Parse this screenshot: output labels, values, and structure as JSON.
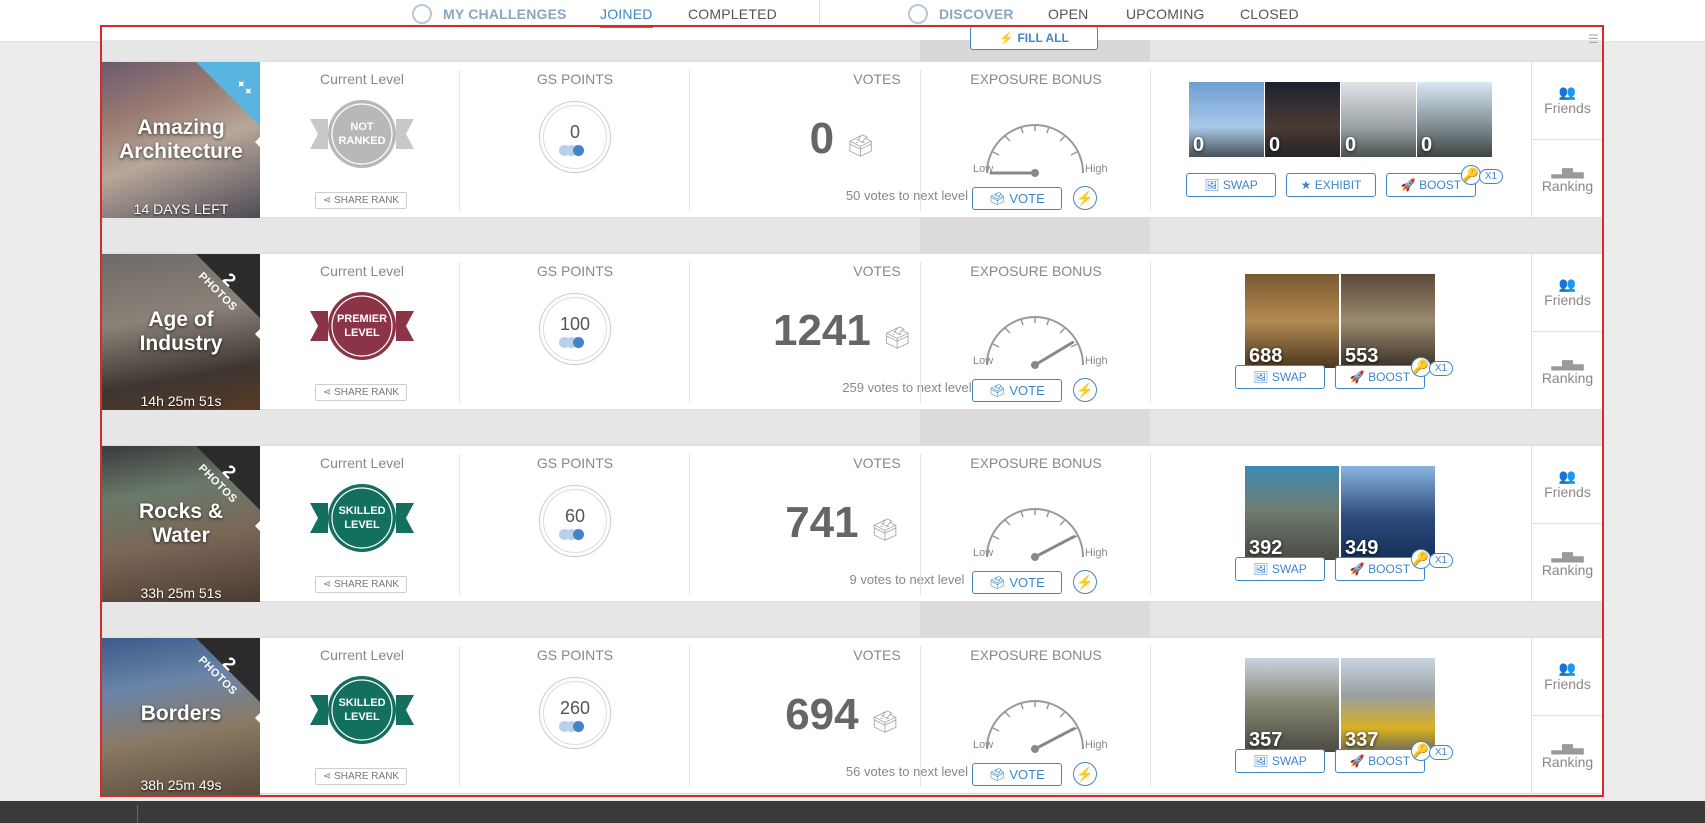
{
  "nav": {
    "my_challenges": "MY CHALLENGES",
    "joined": "JOINED",
    "completed": "COMPLETED",
    "discover": "DISCOVER",
    "open": "OPEN",
    "upcoming": "UPCOMING",
    "closed": "CLOSED"
  },
  "fill_all": "FILL ALL",
  "labels": {
    "current_level": "Current Level",
    "gs_points": "GS POINTS",
    "votes": "VOTES",
    "exposure_bonus": "EXPOSURE BONUS",
    "low": "Low",
    "high": "High",
    "share_rank": "SHARE RANK",
    "vote": "VOTE",
    "swap": "SWAP",
    "exhibit": "EXHIBIT",
    "boost": "BOOST",
    "x1": "X1",
    "friends": "Friends",
    "ranking": "Ranking"
  },
  "challenges": [
    {
      "title_line1": "Amazing",
      "title_line2": "Architecture",
      "timer": "14 DAYS LEFT",
      "ribbon": "",
      "level_line1": "NOT",
      "level_line2": "RANKED",
      "level_color": "#b8b8b8",
      "gs_points": "0",
      "votes": "0",
      "votes_next": "50 votes to next level",
      "exposure": 0.0,
      "photo_counts": [
        "0",
        "0",
        "0",
        "0"
      ]
    },
    {
      "title_line1": "Age of",
      "title_line2": "Industry",
      "timer": "14h 25m 51s",
      "ribbon": "PHOTOS",
      "ribbon_num": "2",
      "level_line1": "PREMIER",
      "level_line2": "LEVEL",
      "level_color": "#8b3447",
      "gs_points": "100",
      "votes": "1241",
      "votes_next": "259 votes to next level",
      "exposure": 0.9,
      "photo_counts": [
        "688",
        "553"
      ]
    },
    {
      "title_line1": "Rocks &",
      "title_line2": "Water",
      "timer": "33h 25m 51s",
      "ribbon": "PHOTOS",
      "ribbon_num": "2",
      "level_line1": "SKILLED",
      "level_line2": "LEVEL",
      "level_color": "#136f5e",
      "gs_points": "60",
      "votes": "741",
      "votes_next": "9 votes to next level",
      "exposure": 0.92,
      "photo_counts": [
        "392",
        "349"
      ]
    },
    {
      "title_line1": "Borders",
      "title_line2": "",
      "timer": "38h 25m 49s",
      "ribbon": "PHOTOS",
      "ribbon_num": "2",
      "level_line1": "SKILLED",
      "level_line2": "LEVEL",
      "level_color": "#136f5e",
      "gs_points": "260",
      "votes": "694",
      "votes_next": "56 votes to next level",
      "exposure": 0.92,
      "photo_counts": [
        "357",
        "337"
      ]
    }
  ],
  "colors": {
    "accent": "#3f86c8",
    "key": "#f2b713",
    "frame": "#d62b2b"
  }
}
